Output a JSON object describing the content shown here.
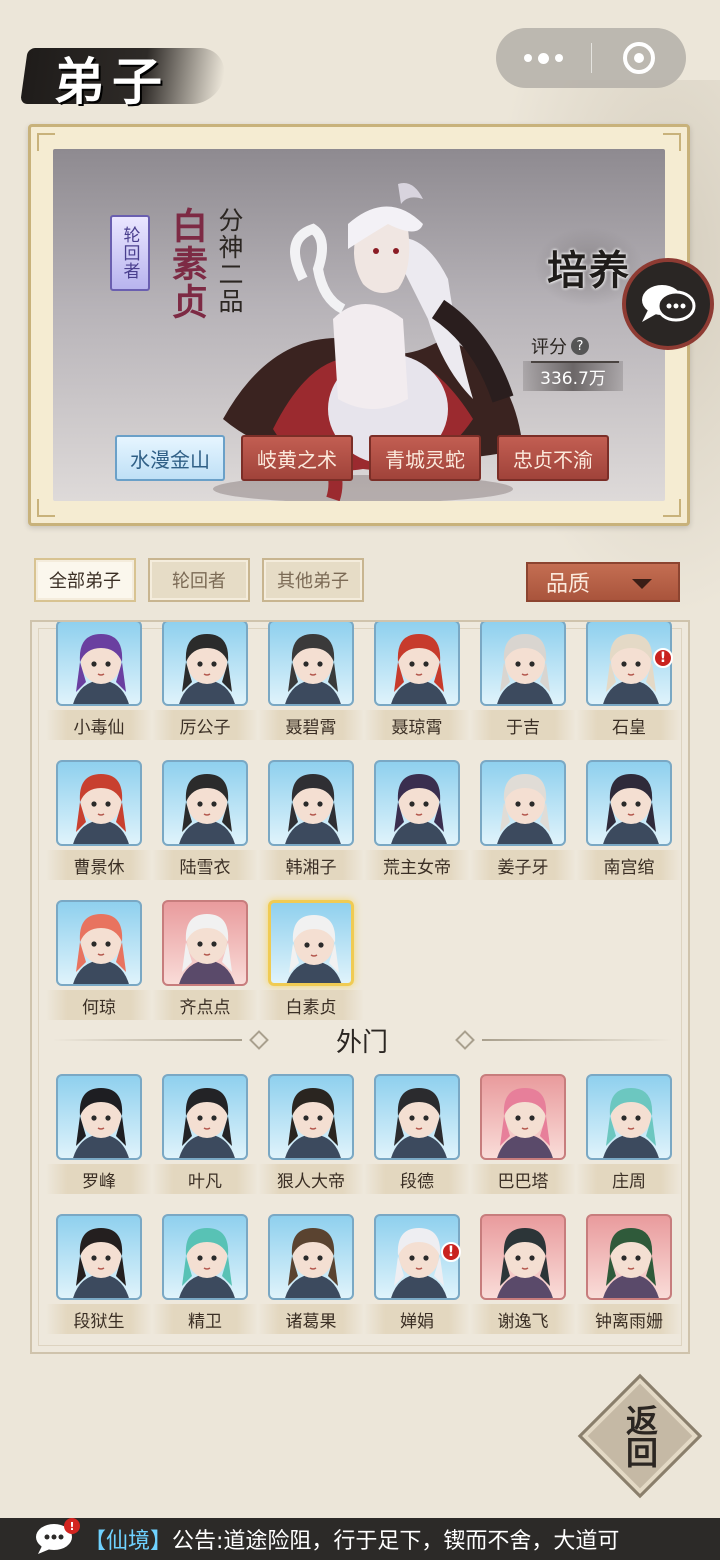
{
  "header": {
    "title": "弟子"
  },
  "hero": {
    "role_badge": "轮回者",
    "name": "白素贞",
    "rank": "分神二品",
    "train_label": "培养",
    "score_label": "评分",
    "score_value": "336.7万",
    "skills": [
      "水漫金山",
      "岐黄之术",
      "青城灵蛇",
      "忠贞不渝"
    ]
  },
  "filters": {
    "tabs": [
      "全部弟子",
      "轮回者",
      "其他弟子"
    ],
    "active": "全部弟子",
    "sort_label": "品质"
  },
  "inner_disciples": [
    {
      "name": "小毒仙",
      "theme": "blue",
      "badge": false
    },
    {
      "name": "厉公子",
      "theme": "blue",
      "badge": false
    },
    {
      "name": "聂碧霄",
      "theme": "blue",
      "badge": false
    },
    {
      "name": "聂琼霄",
      "theme": "blue",
      "badge": false
    },
    {
      "name": "于吉",
      "theme": "blue",
      "badge": false
    },
    {
      "name": "石皇",
      "theme": "blue",
      "badge": true
    },
    {
      "name": "曹景休",
      "theme": "blue",
      "badge": false
    },
    {
      "name": "陆雪衣",
      "theme": "blue",
      "badge": false
    },
    {
      "name": "韩湘子",
      "theme": "blue",
      "badge": false
    },
    {
      "name": "荒主女帝",
      "theme": "blue",
      "badge": false
    },
    {
      "name": "姜子牙",
      "theme": "blue",
      "badge": false
    },
    {
      "name": "南宫绾",
      "theme": "blue",
      "badge": false
    },
    {
      "name": "何琼",
      "theme": "blue",
      "badge": false
    },
    {
      "name": "齐点点",
      "theme": "pink",
      "badge": false
    },
    {
      "name": "白素贞",
      "theme": "blue",
      "badge": false,
      "selected": true
    }
  ],
  "section_label": "外门",
  "outer_disciples": [
    {
      "name": "罗峰",
      "theme": "blue",
      "badge": false
    },
    {
      "name": "叶凡",
      "theme": "blue",
      "badge": false
    },
    {
      "name": "狠人大帝",
      "theme": "blue",
      "badge": false
    },
    {
      "name": "段德",
      "theme": "blue",
      "badge": false
    },
    {
      "name": "巴巴塔",
      "theme": "pink",
      "badge": false
    },
    {
      "name": "庄周",
      "theme": "blue",
      "badge": false
    },
    {
      "name": "段狱生",
      "theme": "blue",
      "badge": false
    },
    {
      "name": "精卫",
      "theme": "blue",
      "badge": false
    },
    {
      "name": "诸葛果",
      "theme": "blue",
      "badge": false
    },
    {
      "name": "婵娟",
      "theme": "blue",
      "badge": true
    },
    {
      "name": "谢逸飞",
      "theme": "pink",
      "badge": false
    },
    {
      "name": "钟离雨姗",
      "theme": "pink",
      "badge": false
    }
  ],
  "badge_mark": "!",
  "back_label": "返回",
  "announcement": {
    "channel": "【仙境】",
    "text": "公告:道途险阻，行于足下，锲而不舍，大道可"
  },
  "colors": {
    "accent_red": "#a9543c",
    "frame_gold": "#c8b27b",
    "selected_gold": "#f0cb53"
  }
}
